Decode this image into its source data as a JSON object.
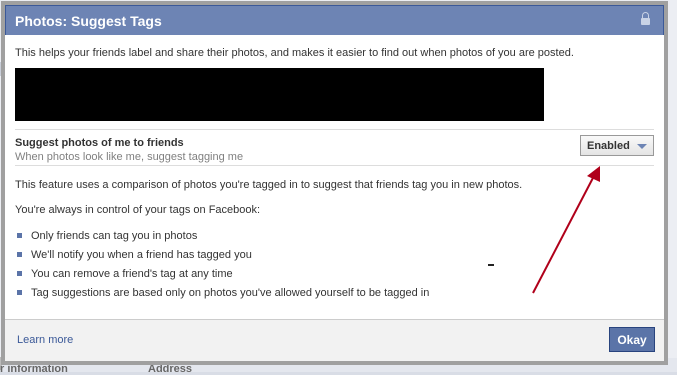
{
  "dialog": {
    "title": "Photos: Suggest Tags",
    "intro": "This helps your friends label and share their photos, and makes it easier to find out when photos of you are posted.",
    "setting": {
      "title": "Suggest photos of me to friends",
      "subtitle": "When photos look like me, suggest tagging me",
      "dropdown_value": "Enabled"
    },
    "description": "This feature uses a comparison of photos you're tagged in to suggest that friends tag you in new photos.",
    "control_note": "You're always in control of your tags on Facebook:",
    "bullets": [
      "Only friends can tag you in photos",
      "We'll notify you when a friend has tagged you",
      "You can remove a friend's tag at any time",
      "Tag suggestions are based only on photos you've allowed yourself to be tagged in"
    ],
    "footer": {
      "learn_more": "Learn more",
      "okay_label": "Okay"
    }
  },
  "background": {
    "left_label": "r information",
    "mid_label": "Address"
  },
  "colors": {
    "titlebar": "#6d84b4",
    "link": "#3b5998",
    "button": "#5b74a8",
    "annotation_arrow": "#b0001a"
  },
  "icons": [
    "lock-icon",
    "chevron-down-icon",
    "arrow-annotation"
  ]
}
